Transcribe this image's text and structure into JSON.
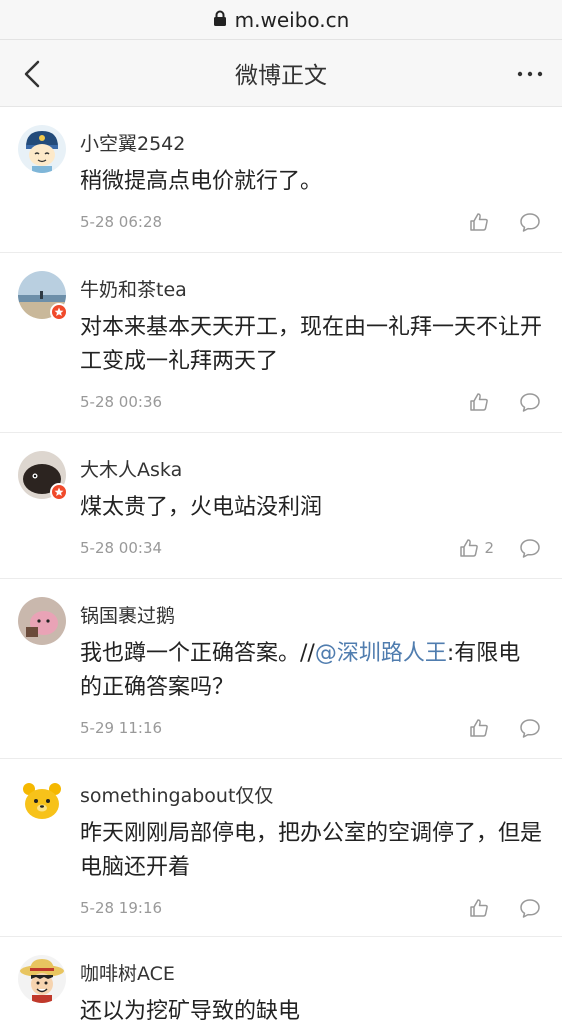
{
  "url": {
    "text": "m.weibo.cn"
  },
  "nav": {
    "title": "微博正文"
  },
  "comments": [
    {
      "user": "小空翼2542",
      "text": "稍微提高点电价就行了。",
      "time": "5-28 06:28",
      "likes": "",
      "avatar_icon": "cartoon-face-avatar-icon"
    },
    {
      "user": "牛奶和茶tea",
      "text": "对本来基本天天开工，现在由一礼拜一天不让开工变成一礼拜两天了",
      "time": "5-28 00:36",
      "likes": "",
      "avatar_icon": "beach-photo-avatar-icon"
    },
    {
      "user": "大木人Aska",
      "text": "煤太贵了，火电站没利润",
      "time": "5-28 00:34",
      "likes": "2",
      "avatar_icon": "dark-creature-avatar-icon"
    },
    {
      "user": "锅国裹过鹅",
      "text_before": "我也蹲一个正确答案。//",
      "mention": "@深圳路人王",
      "text_after": ":有限电的正确答案吗？",
      "time": "5-29 11:16",
      "likes": "",
      "avatar_icon": "pink-character-avatar-icon"
    },
    {
      "user": "somethingabout仅仅",
      "text": "昨天刚刚局部停电，把办公室的空调停了，但是电脑还开着",
      "time": "5-28 19:16",
      "likes": "",
      "avatar_icon": "yellow-bear-avatar-icon"
    },
    {
      "user": "咖啡树ACE",
      "text": "还以为挖矿导致的缺电",
      "time": "",
      "likes": "",
      "avatar_icon": "straw-hat-avatar-icon"
    }
  ],
  "colors": {
    "mention": "#507daf",
    "badge": "#f04a2b",
    "nav_bg": "#f7f7f7"
  }
}
